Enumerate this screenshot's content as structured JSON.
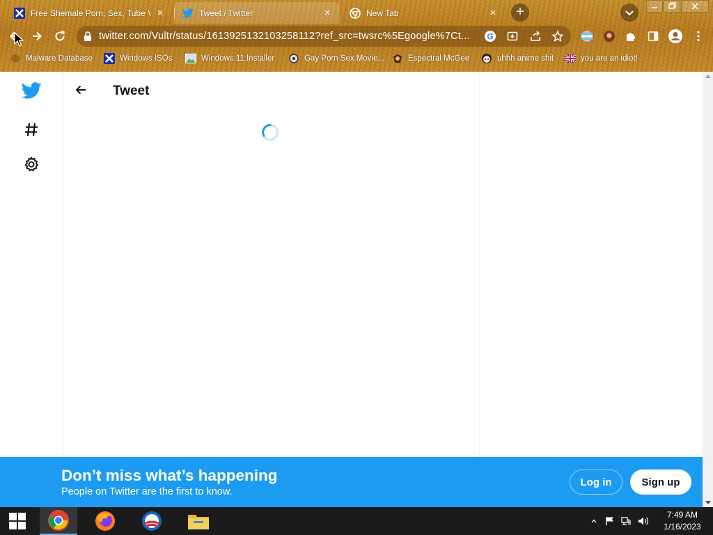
{
  "browser": {
    "tabs": [
      {
        "title": "Free Shemale Porn, Sex, Tube Vid",
        "favicon": "x-icon"
      },
      {
        "title": "Tweet / Twitter",
        "favicon": "twitter-bird-icon"
      },
      {
        "title": "New Tab",
        "favicon": "chrome-icon"
      }
    ],
    "url": "twitter.com/Vultr/status/1613925132103258112?ref_src=twsrc%5Egoogle%7Ct...",
    "bookmarks": [
      {
        "label": "Malware Database"
      },
      {
        "label": "Windows ISOs"
      },
      {
        "label": "Windows 11 Installer"
      },
      {
        "label": "Gay Porn Sex Movie..."
      },
      {
        "label": "Espectral McGee"
      },
      {
        "label": "uhhh anime shit"
      },
      {
        "label": "you are an idiot!"
      }
    ]
  },
  "page": {
    "title": "Tweet",
    "accent": "#1d9bf0"
  },
  "banner": {
    "title": "Don’t miss what’s happening",
    "subtitle": "People on Twitter are the first to know.",
    "login_label": "Log in",
    "signup_label": "Sign up"
  },
  "taskbar": {
    "time": "7:49 AM",
    "date": "1/16/2023"
  }
}
